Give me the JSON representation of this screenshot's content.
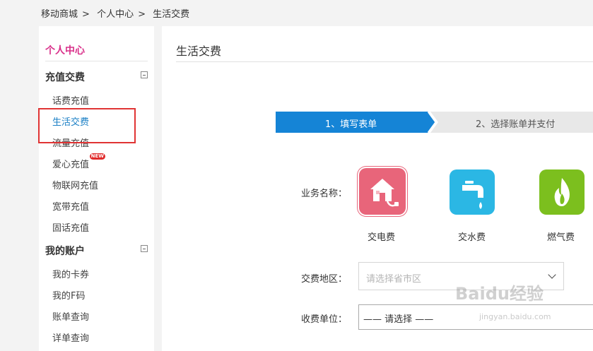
{
  "breadcrumb": [
    "移动商城",
    "个人中心",
    "生活交费"
  ],
  "sidebar": {
    "title": "个人中心",
    "sections": [
      {
        "label": "充值交费",
        "items": [
          "话费充值",
          "生活交费",
          "流量充值",
          "爱心充值",
          "物联网充值",
          "宽带充值",
          "固话充值"
        ]
      },
      {
        "label": "我的账户",
        "items": [
          "我的卡券",
          "我的F码",
          "账单查询",
          "详单查询"
        ]
      }
    ],
    "new_badge": "NEW"
  },
  "main": {
    "title": "生活交费",
    "steps": [
      "1、填写表单",
      "2、选择账单并支付"
    ],
    "service_label": "业务名称：",
    "services": [
      {
        "name": "交电费",
        "icon": "house-plug-icon",
        "color": "#e8657a"
      },
      {
        "name": "交水费",
        "icon": "faucet-icon",
        "color": "#2bb7e4"
      },
      {
        "name": "燃气费",
        "icon": "flame-icon",
        "color": "#7cbf1e"
      }
    ],
    "region_label": "交费地区：",
    "region_placeholder": "请选择省市区",
    "unit_label": "收费单位：",
    "unit_value": "—— 请选择 ——"
  },
  "colors": {
    "accent_pink": "#d9308a",
    "active_blue": "#1a7fc5",
    "step_active": "#1584d6",
    "step_inactive": "#e8e8e8",
    "highlight": "#e03434"
  },
  "watermark": {
    "text": "Baidu经验",
    "sub": "jingyan.baidu.com"
  }
}
